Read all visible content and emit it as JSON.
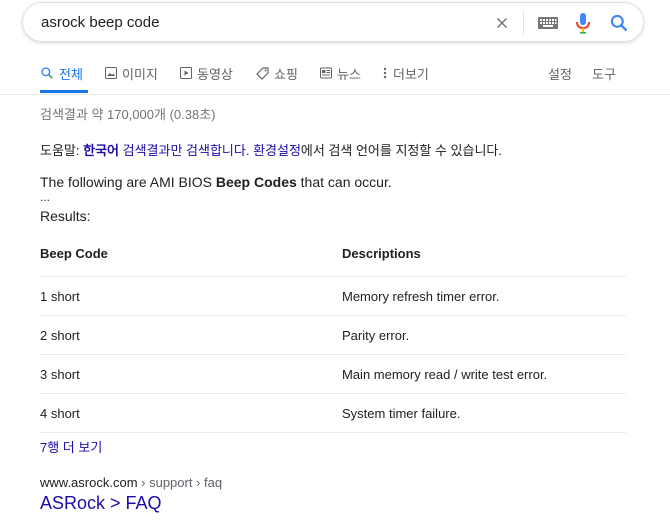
{
  "search": {
    "query": "asrock beep code"
  },
  "tabs": [
    {
      "label": "전체",
      "icon": "search-icon",
      "active": true
    },
    {
      "label": "이미지",
      "icon": "image-icon"
    },
    {
      "label": "동영상",
      "icon": "video-icon"
    },
    {
      "label": "쇼핑",
      "icon": "tag-icon"
    },
    {
      "label": "뉴스",
      "icon": "news-icon"
    },
    {
      "label": "더보기",
      "icon": "more-vert-icon"
    }
  ],
  "tools": {
    "settings": "설정",
    "tools": "도구"
  },
  "stats": "검색결과 약 170,000개 (0.38초)",
  "lang_note": {
    "prefix": "도움말: ",
    "korean_link": "한국어",
    "middle": " 검색결과만 검색합니다. ",
    "settings_link": "환경설정",
    "suffix": "에서 검색 언어를 지정할 수 있습니다."
  },
  "snippet": {
    "before": "The following are AMI BIOS ",
    "bold": "Beep Codes",
    "after": " that can occur.",
    "ellipsis": "...",
    "results_label": "Results:"
  },
  "table": {
    "headers": [
      "Beep Code",
      "Descriptions"
    ],
    "rows": [
      [
        "1 short",
        "Memory refresh timer error."
      ],
      [
        "2 short",
        "Parity error."
      ],
      [
        "3 short",
        "Main memory read / write test error."
      ],
      [
        "4 short",
        "System timer failure."
      ]
    ]
  },
  "more_rows": "7행 더 보기",
  "result": {
    "domain": "www.asrock.com",
    "path": " › support › faq",
    "title": "ASRock > FAQ"
  },
  "colors": {
    "link": "#1a0dab",
    "accent": "#1a73e8",
    "muted": "#70757a"
  }
}
